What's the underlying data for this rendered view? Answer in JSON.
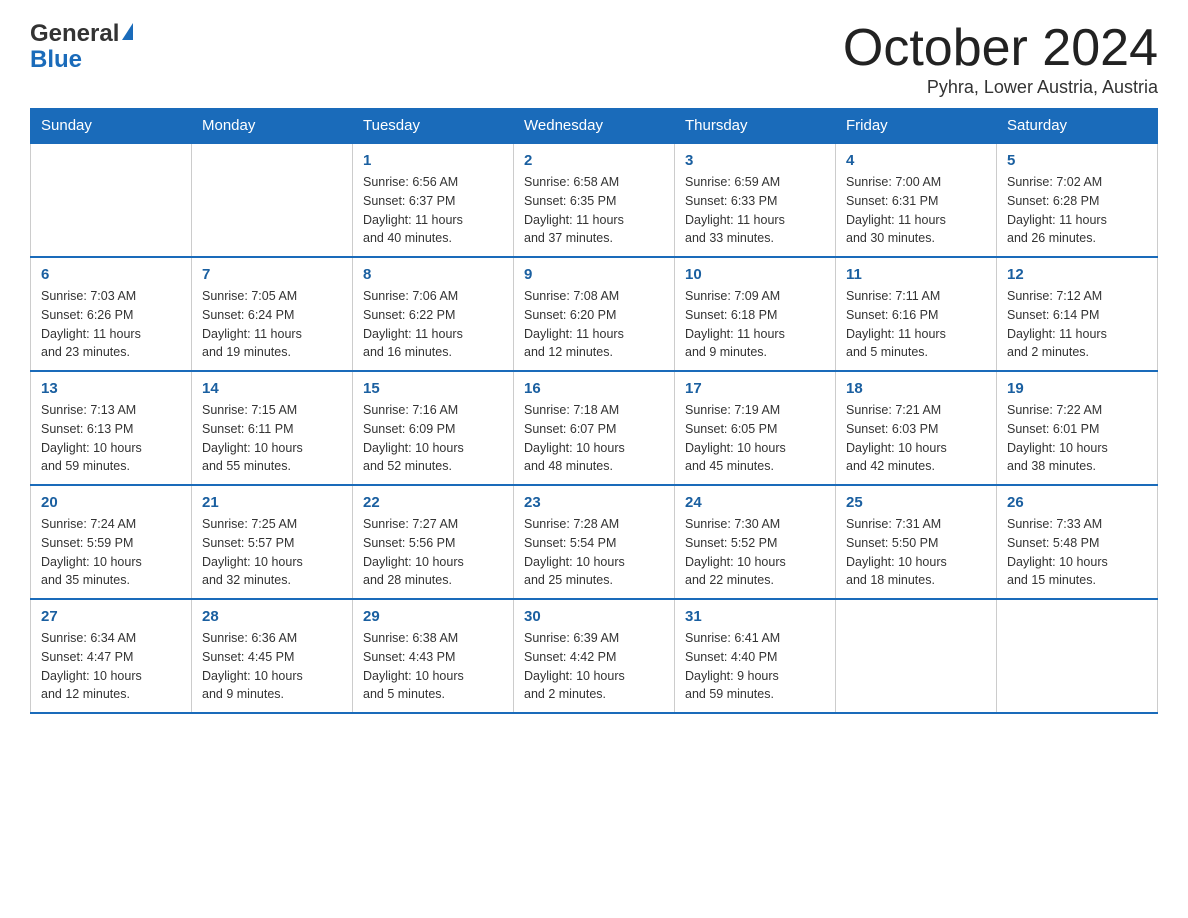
{
  "header": {
    "logo_general": "General",
    "logo_blue": "Blue",
    "month_title": "October 2024",
    "location": "Pyhra, Lower Austria, Austria"
  },
  "days_of_week": [
    "Sunday",
    "Monday",
    "Tuesday",
    "Wednesday",
    "Thursday",
    "Friday",
    "Saturday"
  ],
  "weeks": [
    [
      {
        "day": "",
        "info": ""
      },
      {
        "day": "",
        "info": ""
      },
      {
        "day": "1",
        "info": "Sunrise: 6:56 AM\nSunset: 6:37 PM\nDaylight: 11 hours\nand 40 minutes."
      },
      {
        "day": "2",
        "info": "Sunrise: 6:58 AM\nSunset: 6:35 PM\nDaylight: 11 hours\nand 37 minutes."
      },
      {
        "day": "3",
        "info": "Sunrise: 6:59 AM\nSunset: 6:33 PM\nDaylight: 11 hours\nand 33 minutes."
      },
      {
        "day": "4",
        "info": "Sunrise: 7:00 AM\nSunset: 6:31 PM\nDaylight: 11 hours\nand 30 minutes."
      },
      {
        "day": "5",
        "info": "Sunrise: 7:02 AM\nSunset: 6:28 PM\nDaylight: 11 hours\nand 26 minutes."
      }
    ],
    [
      {
        "day": "6",
        "info": "Sunrise: 7:03 AM\nSunset: 6:26 PM\nDaylight: 11 hours\nand 23 minutes."
      },
      {
        "day": "7",
        "info": "Sunrise: 7:05 AM\nSunset: 6:24 PM\nDaylight: 11 hours\nand 19 minutes."
      },
      {
        "day": "8",
        "info": "Sunrise: 7:06 AM\nSunset: 6:22 PM\nDaylight: 11 hours\nand 16 minutes."
      },
      {
        "day": "9",
        "info": "Sunrise: 7:08 AM\nSunset: 6:20 PM\nDaylight: 11 hours\nand 12 minutes."
      },
      {
        "day": "10",
        "info": "Sunrise: 7:09 AM\nSunset: 6:18 PM\nDaylight: 11 hours\nand 9 minutes."
      },
      {
        "day": "11",
        "info": "Sunrise: 7:11 AM\nSunset: 6:16 PM\nDaylight: 11 hours\nand 5 minutes."
      },
      {
        "day": "12",
        "info": "Sunrise: 7:12 AM\nSunset: 6:14 PM\nDaylight: 11 hours\nand 2 minutes."
      }
    ],
    [
      {
        "day": "13",
        "info": "Sunrise: 7:13 AM\nSunset: 6:13 PM\nDaylight: 10 hours\nand 59 minutes."
      },
      {
        "day": "14",
        "info": "Sunrise: 7:15 AM\nSunset: 6:11 PM\nDaylight: 10 hours\nand 55 minutes."
      },
      {
        "day": "15",
        "info": "Sunrise: 7:16 AM\nSunset: 6:09 PM\nDaylight: 10 hours\nand 52 minutes."
      },
      {
        "day": "16",
        "info": "Sunrise: 7:18 AM\nSunset: 6:07 PM\nDaylight: 10 hours\nand 48 minutes."
      },
      {
        "day": "17",
        "info": "Sunrise: 7:19 AM\nSunset: 6:05 PM\nDaylight: 10 hours\nand 45 minutes."
      },
      {
        "day": "18",
        "info": "Sunrise: 7:21 AM\nSunset: 6:03 PM\nDaylight: 10 hours\nand 42 minutes."
      },
      {
        "day": "19",
        "info": "Sunrise: 7:22 AM\nSunset: 6:01 PM\nDaylight: 10 hours\nand 38 minutes."
      }
    ],
    [
      {
        "day": "20",
        "info": "Sunrise: 7:24 AM\nSunset: 5:59 PM\nDaylight: 10 hours\nand 35 minutes."
      },
      {
        "day": "21",
        "info": "Sunrise: 7:25 AM\nSunset: 5:57 PM\nDaylight: 10 hours\nand 32 minutes."
      },
      {
        "day": "22",
        "info": "Sunrise: 7:27 AM\nSunset: 5:56 PM\nDaylight: 10 hours\nand 28 minutes."
      },
      {
        "day": "23",
        "info": "Sunrise: 7:28 AM\nSunset: 5:54 PM\nDaylight: 10 hours\nand 25 minutes."
      },
      {
        "day": "24",
        "info": "Sunrise: 7:30 AM\nSunset: 5:52 PM\nDaylight: 10 hours\nand 22 minutes."
      },
      {
        "day": "25",
        "info": "Sunrise: 7:31 AM\nSunset: 5:50 PM\nDaylight: 10 hours\nand 18 minutes."
      },
      {
        "day": "26",
        "info": "Sunrise: 7:33 AM\nSunset: 5:48 PM\nDaylight: 10 hours\nand 15 minutes."
      }
    ],
    [
      {
        "day": "27",
        "info": "Sunrise: 6:34 AM\nSunset: 4:47 PM\nDaylight: 10 hours\nand 12 minutes."
      },
      {
        "day": "28",
        "info": "Sunrise: 6:36 AM\nSunset: 4:45 PM\nDaylight: 10 hours\nand 9 minutes."
      },
      {
        "day": "29",
        "info": "Sunrise: 6:38 AM\nSunset: 4:43 PM\nDaylight: 10 hours\nand 5 minutes."
      },
      {
        "day": "30",
        "info": "Sunrise: 6:39 AM\nSunset: 4:42 PM\nDaylight: 10 hours\nand 2 minutes."
      },
      {
        "day": "31",
        "info": "Sunrise: 6:41 AM\nSunset: 4:40 PM\nDaylight: 9 hours\nand 59 minutes."
      },
      {
        "day": "",
        "info": ""
      },
      {
        "day": "",
        "info": ""
      }
    ]
  ]
}
